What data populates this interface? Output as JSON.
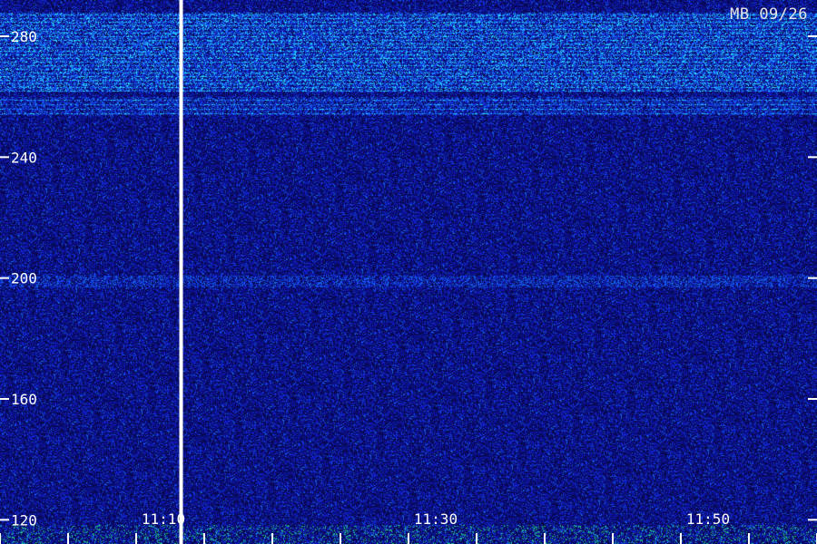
{
  "station_label": "MB 09/26",
  "chart_data": {
    "type": "heatmap",
    "title": "",
    "xlabel": "",
    "ylabel": "",
    "y_ticks": [
      "280",
      "240",
      "200",
      "160",
      "120"
    ],
    "y_tick_values": [
      280,
      240,
      200,
      160,
      120
    ],
    "ylim": [
      112,
      292
    ],
    "x_ticks": [
      "11:10",
      "11:30",
      "11:50"
    ],
    "x_tick_minutes": [
      70,
      90,
      110
    ],
    "xlim_minutes": [
      58,
      118
    ],
    "minor_tick_interval_minutes": 5,
    "marker_time_minutes": 71.3,
    "bands": [
      {
        "range": [
          262,
          288
        ],
        "description": "strong horizontal echo lines"
      },
      {
        "range": [
          254,
          260
        ],
        "description": "moderate echo lines"
      },
      {
        "range": [
          197,
          201
        ],
        "description": "faint bright band"
      }
    ],
    "colors": {
      "background": "#0a0a55",
      "noise_high": "#1e5aff",
      "echo": "#40e0ff",
      "marker": "#ffffff"
    },
    "grid": false
  }
}
